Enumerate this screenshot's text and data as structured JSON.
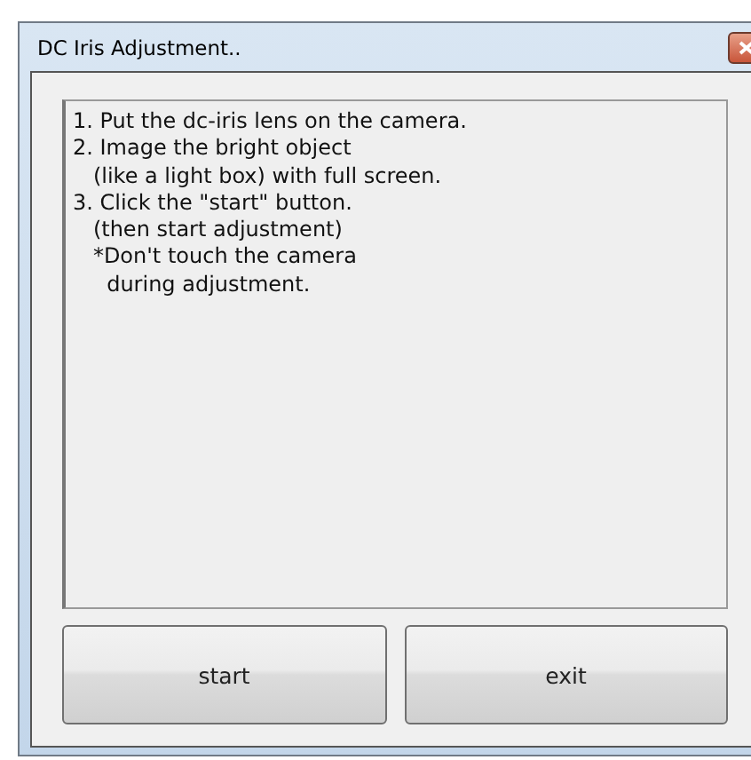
{
  "window": {
    "title": "DC Iris Adjustment.."
  },
  "instructions": {
    "lines": [
      "1. Put the dc-iris lens on the camera.",
      "2. Image the bright object",
      "   (like a light box) with full screen.",
      "3. Click the \"start\" button.",
      "   (then start adjustment)",
      "   *Don't touch the camera",
      "     during adjustment."
    ]
  },
  "buttons": [
    {
      "label": "start"
    },
    {
      "label": "exit"
    }
  ]
}
